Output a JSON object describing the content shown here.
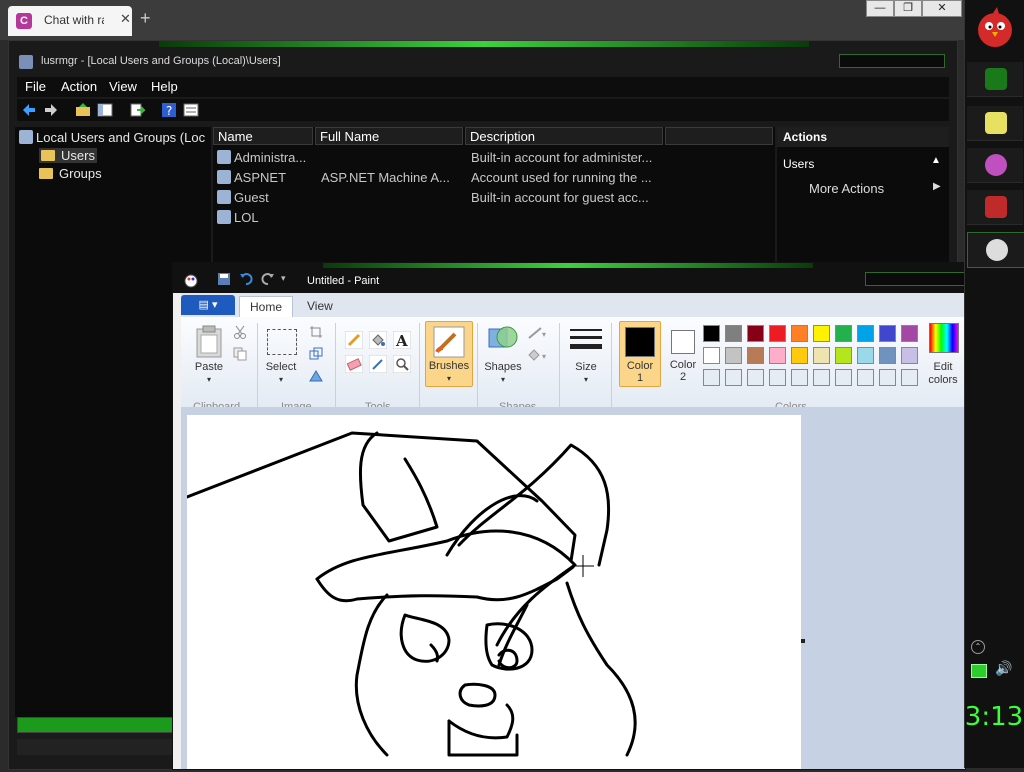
{
  "browser": {
    "tab_title": "Chat with ra",
    "tab_icon_letter": "C",
    "new_tab": "+",
    "tab_close": "✕",
    "win_min": "—",
    "win_max": "❐",
    "win_close": "✕"
  },
  "mmc": {
    "title": "lusrmgr - [Local Users and Groups (Local)\\Users]",
    "menu": [
      "File",
      "Action",
      "View",
      "Help"
    ],
    "tree": {
      "root": "Local Users and Groups (Loc",
      "items": [
        "Users",
        "Groups"
      ]
    },
    "columns": [
      "Name",
      "Full Name",
      "Description"
    ],
    "rows": [
      {
        "name": "Administra...",
        "full_name": "",
        "description": "Built-in account for administer..."
      },
      {
        "name": "ASPNET",
        "full_name": "ASP.NET Machine A...",
        "description": "Account used for running the ..."
      },
      {
        "name": "Guest",
        "full_name": "",
        "description": "Built-in account for guest acc..."
      },
      {
        "name": "LOL",
        "full_name": "",
        "description": ""
      }
    ],
    "actions": {
      "header": "Actions",
      "section": "Users",
      "more": "More Actions"
    }
  },
  "paint": {
    "title": "Untitled - Paint",
    "tabs": [
      "Home",
      "View"
    ],
    "groups": {
      "clipboard": "Clipboard",
      "image": "Image",
      "tools": "Tools",
      "shapes": "Shapes",
      "colors": "Colors"
    },
    "buttons": {
      "paste": "Paste",
      "select": "Select",
      "brushes": "Brushes",
      "shapes": "Shapes",
      "size": "Size",
      "color1_a": "Color",
      "color1_b": "1",
      "color2_a": "Color",
      "color2_b": "2",
      "edit_a": "Edit",
      "edit_b": "colors"
    },
    "palette_row1": [
      "#000000",
      "#7f7f7f",
      "#880015",
      "#ed1c24",
      "#ff7f27",
      "#fff200",
      "#22b14c",
      "#00a2e8",
      "#3f48cc",
      "#a349a4"
    ],
    "palette_row2": [
      "#ffffff",
      "#c3c3c3",
      "#b97a57",
      "#ffaec9",
      "#ffc90e",
      "#efe4b0",
      "#b5e61d",
      "#99d9ea",
      "#7092be",
      "#c8bfe7"
    ],
    "color1": "#000000",
    "color2": "#ffffff"
  },
  "taskbar": {
    "clock": "3:13"
  }
}
